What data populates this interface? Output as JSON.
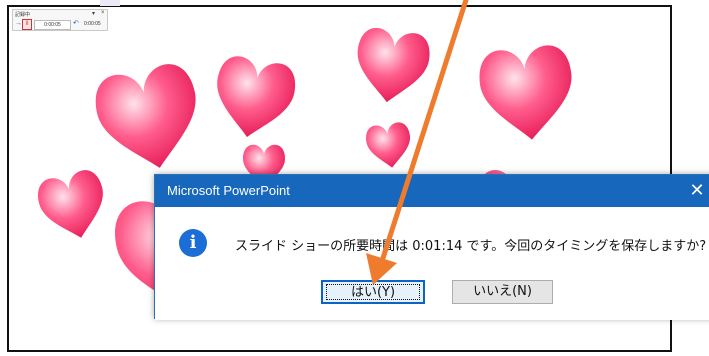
{
  "recording_toolbar": {
    "title": "記録中",
    "dropdown_glyph": "▾",
    "close_glyph": "×",
    "next_glyph": "→",
    "pause_glyph": "II",
    "slide_time": "0:00:05",
    "repeat_glyph": "↶",
    "total_time": "0:00:05"
  },
  "dialog": {
    "title": "Microsoft PowerPoint",
    "close_glyph": "✕",
    "icon": "info-icon",
    "icon_glyph": "i",
    "message": "スライド ショーの所要時間は 0:01:14 です。今回のタイミングを保存しますか?",
    "yes_label": "はい(Y)",
    "no_label": "いいえ(N)"
  },
  "colors": {
    "heart": "#f02a6a",
    "titlebar": "#1767bc",
    "arrow": "#ee7c2c"
  }
}
